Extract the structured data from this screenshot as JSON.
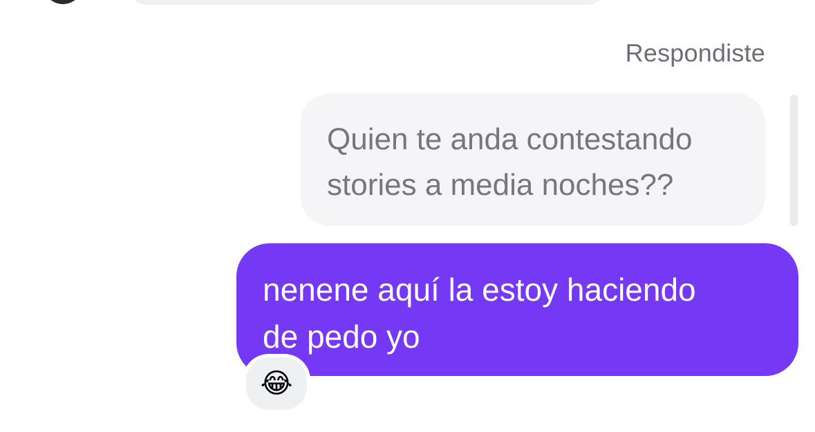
{
  "thread": {
    "reply_context_label": "Respondiste",
    "quoted_message": "Quien te anda contestando\nstories a media noches??",
    "sent_message": "nenene aquí la estoy haciendo\nde pedo yo",
    "reaction_emoji": "😂",
    "reaction_icon": "face-with-tears-of-joy-icon"
  },
  "colors": {
    "sent_bubble": "#7539f5",
    "quoted_bubble": "#f5f5f7",
    "label_text": "#6b6e74"
  }
}
